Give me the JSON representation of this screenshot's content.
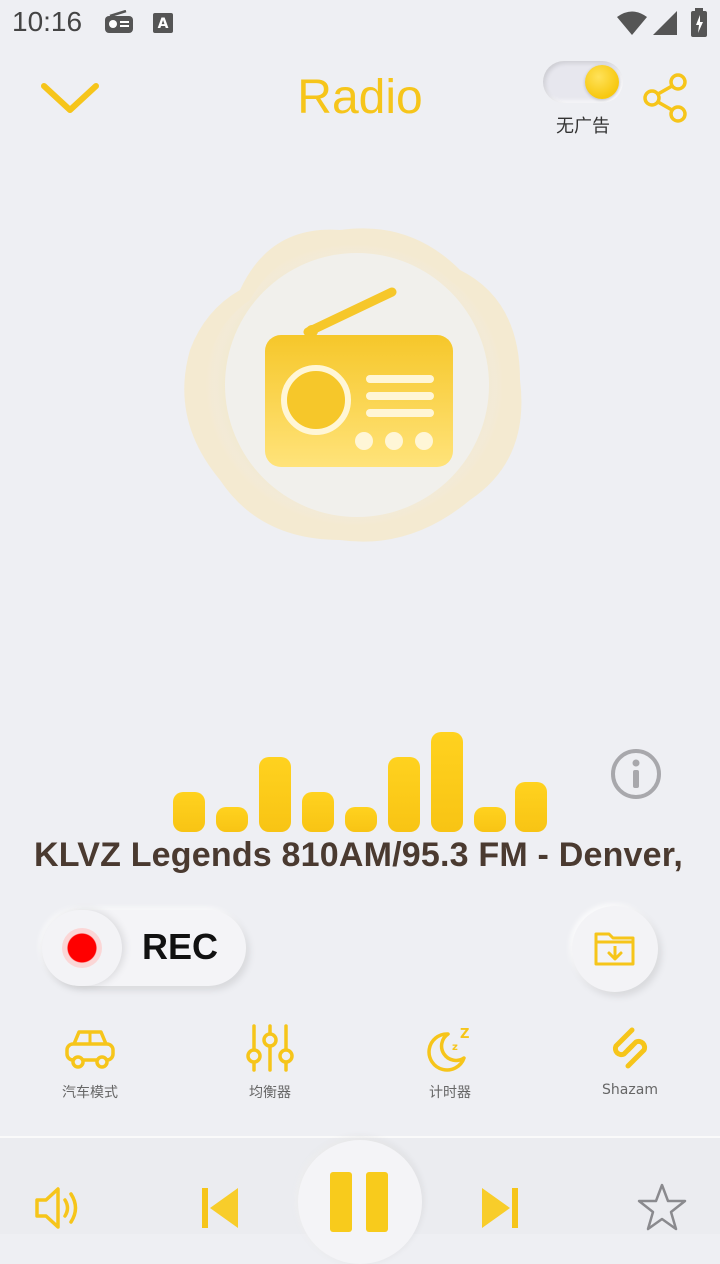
{
  "status_bar": {
    "time": "10:16",
    "icons": [
      "radio-notification-icon",
      "a-notification-icon",
      "wifi-icon",
      "signal-icon",
      "battery-icon"
    ]
  },
  "header": {
    "title": "Radio",
    "adfree_label": "无广告",
    "adfree_enabled": true,
    "icons": [
      "chevron-down-icon",
      "share-icon"
    ]
  },
  "player": {
    "station_name": "KLVZ Legends 810AM/95.3 FM - Denver,",
    "rec_label": "REC",
    "state": "playing"
  },
  "features": [
    {
      "label": "汽车模式",
      "icon": "car-icon"
    },
    {
      "label": "均衡器",
      "icon": "equalizer-icon"
    },
    {
      "label": "计时器",
      "icon": "sleep-timer-icon"
    },
    {
      "label": "Shazam",
      "icon": "shazam-icon"
    }
  ],
  "controls": [
    "volume-icon",
    "previous-icon",
    "pause-icon",
    "next-icon",
    "star-icon"
  ],
  "colors": {
    "accent": "#f6c51a",
    "background": "#eeeff3",
    "station_text": "#4a3a30",
    "record_red": "#ff0000"
  }
}
